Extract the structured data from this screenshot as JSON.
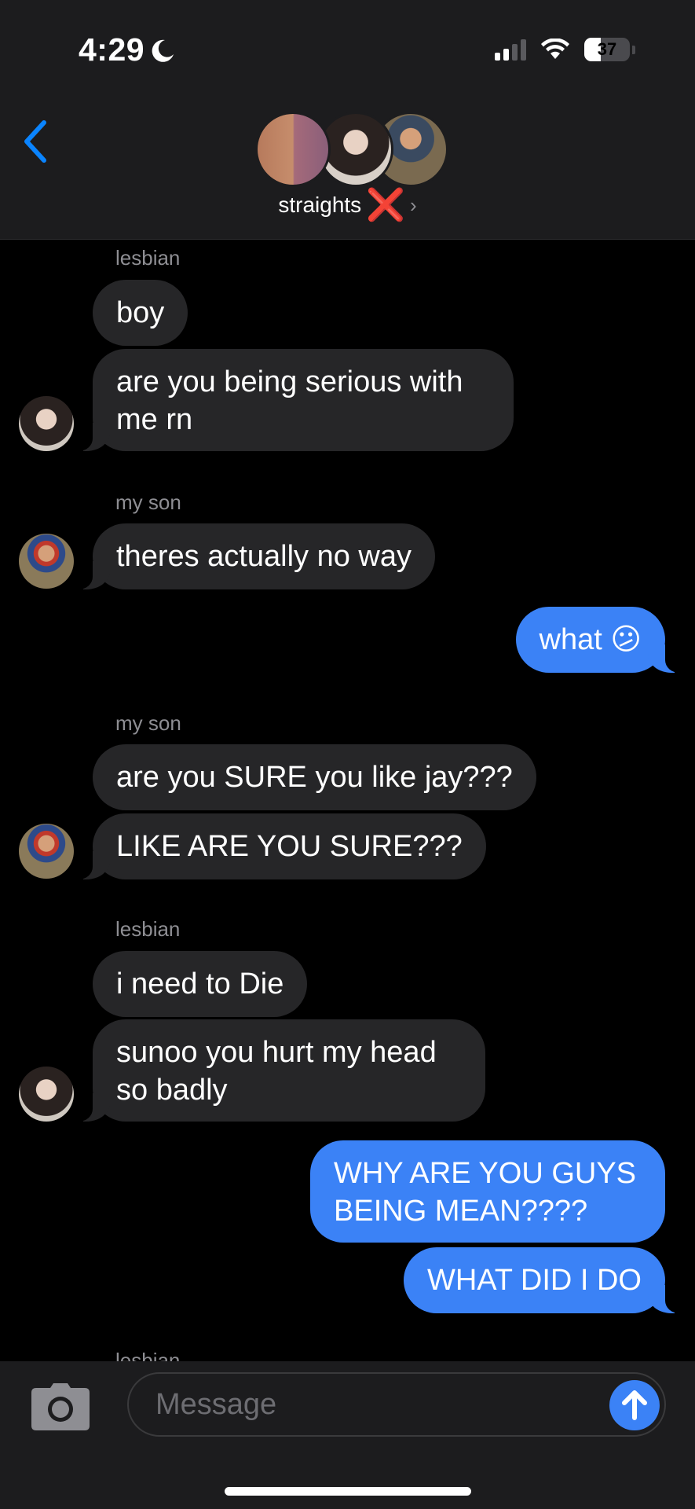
{
  "status_bar": {
    "time": "4:29",
    "battery": "37",
    "battery_level": 0.37
  },
  "header": {
    "group_name": "straights",
    "name_emoji": "❌"
  },
  "messages": [
    {
      "sender": "lesbian",
      "text": "boy"
    },
    {
      "text": "are you being serious with",
      "text2": "me rn"
    },
    {
      "sender": "my son",
      "text": "theres actually no way"
    },
    {
      "text": "what 😕"
    },
    {
      "sender": "my son",
      "text": "are you SURE you like jay???"
    },
    {
      "text": "LIKE ARE YOU SURE???"
    },
    {
      "sender": "lesbian",
      "text": "i need to Die"
    },
    {
      "text": "sunoo you hurt my head",
      "text2": "so badly"
    },
    {
      "text": "WHY ARE YOU GUYS",
      "text2": "BEING MEAN????"
    },
    {
      "text": "WHAT DID I DO"
    },
    {
      "sender": "lesbian"
    }
  ],
  "composer": {
    "placeholder": "Message"
  },
  "icons": {
    "back": "chevron-left-icon",
    "camera": "camera-icon",
    "send": "arrow-up-icon",
    "moon": "moon-icon",
    "signal": "signal-icon",
    "wifi": "wifi-icon",
    "battery": "battery-icon"
  },
  "colors": {
    "accent": "#3b82f6",
    "incoming_bubble": "#262628",
    "header_bg": "#1c1c1e"
  }
}
